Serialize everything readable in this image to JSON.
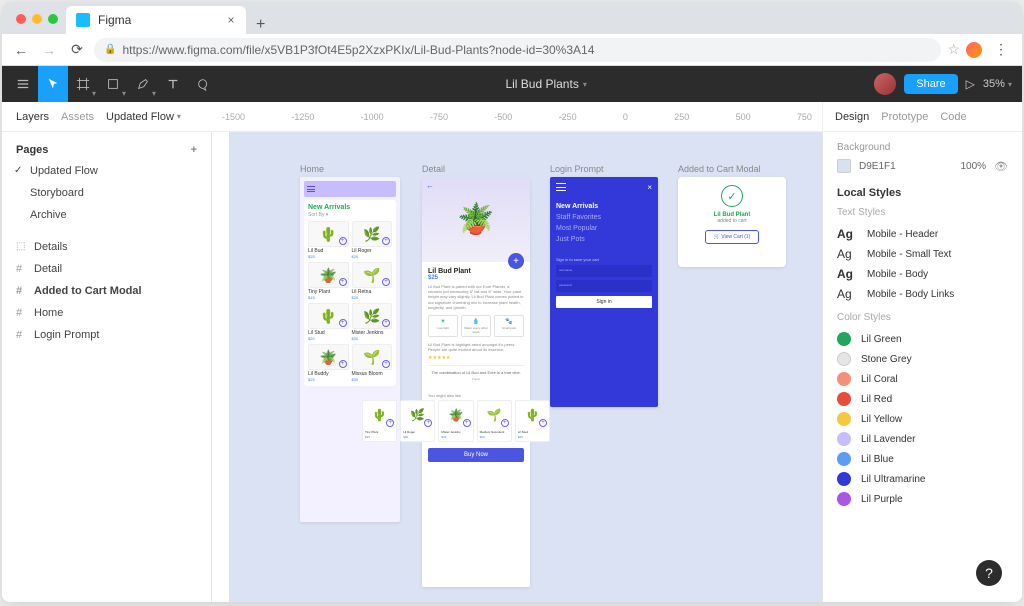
{
  "browser": {
    "tab_title": "Figma",
    "url": "https://www.figma.com/file/x5VB1P3fOt4E5p2XzxPKIx/Lil-Bud-Plants?node-id=30%3A14"
  },
  "toolbar": {
    "file_name": "Lil Bud Plants",
    "share": "Share",
    "zoom": "35%"
  },
  "left": {
    "tab_layers": "Layers",
    "tab_assets": "Assets",
    "page_dropdown": "Updated Flow",
    "pages_label": "Pages",
    "pages": [
      "Updated Flow",
      "Storyboard",
      "Archive"
    ],
    "layers": [
      {
        "name": "Details",
        "type": "comp"
      },
      {
        "name": "Detail",
        "type": "frame"
      },
      {
        "name": "Added to Cart Modal",
        "type": "frame",
        "bold": true
      },
      {
        "name": "Home",
        "type": "frame"
      },
      {
        "name": "Login Prompt",
        "type": "frame"
      }
    ]
  },
  "canvas": {
    "ruler_marks": [
      "-1500",
      "-1250",
      "-1000",
      "-750",
      "-500",
      "-250",
      "0",
      "250",
      "500",
      "750"
    ],
    "frames": {
      "home": {
        "label": "Home",
        "new_arrivals": "New Arrivals",
        "sort_by": "Sort By ▾",
        "products": [
          {
            "name": "Lil Bud",
            "price": "$25"
          },
          {
            "name": "Lil Roger",
            "price": "$20"
          },
          {
            "name": "Tiny Plant",
            "price": "$15"
          },
          {
            "name": "Lil Retna",
            "price": "$20"
          },
          {
            "name": "Lil Stud",
            "price": "$20"
          },
          {
            "name": "Mister Jenkins",
            "price": "$30"
          },
          {
            "name": "Lil Buddy",
            "price": "$25"
          },
          {
            "name": "Missus Bloom",
            "price": "$30"
          }
        ]
      },
      "detail": {
        "label": "Detail",
        "title": "Lil Bud Plant",
        "price": "$25",
        "desc": "Lil Bud Plant is paired with our Eore Planter, a ceramic pot measuring 5\" tall and 6\" wide. Your plant height may vary slightly. Lil Bud Plant comes potted in our signature crumbling mix to increase plant health, longevity, and growth.",
        "chips": [
          "Low light",
          "Water every other week",
          "Small pets"
        ],
        "review": "Lil Bud Plant is highlight-rated amongst it's peers. People are quite excited about its essence.",
        "combo": "The combination of Lil Bud and Eore is a true vibe.",
        "by": "Tracie",
        "might_like": "You might also like",
        "suggest": [
          {
            "name": "Tiny Plant",
            "price": "$15"
          },
          {
            "name": "Lil Roger",
            "price": "$20"
          },
          {
            "name": "Mister Jenkins",
            "price": "$30"
          },
          {
            "name": "Medium Succulent",
            "price": "$20"
          },
          {
            "name": "Lil Stud",
            "price": "$20"
          }
        ],
        "buy": "Buy Now"
      },
      "login": {
        "label": "Login Prompt",
        "nav": [
          "New Arrivals",
          "Staff Favorites",
          "Most Popular",
          "Just Pots"
        ],
        "signin_label": "Sign in to save your cart",
        "username": "username",
        "password": "password",
        "button": "Sign in"
      },
      "cart": {
        "label": "Added to Cart Modal",
        "name": "Lil Bud Plant",
        "sub": "added to cart",
        "button": "🛒 View Cart (1)"
      }
    }
  },
  "right": {
    "tab_design": "Design",
    "tab_proto": "Prototype",
    "tab_code": "Code",
    "bg_label": "Background",
    "bg_hex": "D9E1F1",
    "bg_pct": "100%",
    "local_styles": "Local Styles",
    "text_styles_label": "Text Styles",
    "text_styles": [
      "Mobile - Header",
      "Mobile - Small Text",
      "Mobile - Body",
      "Mobile - Body Links"
    ],
    "color_styles_label": "Color Styles",
    "color_styles": [
      {
        "name": "Lil Green",
        "hex": "#22a55c"
      },
      {
        "name": "Stone Grey",
        "hex": "#e5e5e5"
      },
      {
        "name": "Lil Coral",
        "hex": "#f58e7a"
      },
      {
        "name": "Lil Red",
        "hex": "#e74c3c"
      },
      {
        "name": "Lil Yellow",
        "hex": "#f5c842"
      },
      {
        "name": "Lil Lavender",
        "hex": "#c7bdfc"
      },
      {
        "name": "Lil Blue",
        "hex": "#5b9cf5"
      },
      {
        "name": "Lil Ultramarine",
        "hex": "#3339d8"
      },
      {
        "name": "Lil Purple",
        "hex": "#a855e8"
      }
    ]
  }
}
